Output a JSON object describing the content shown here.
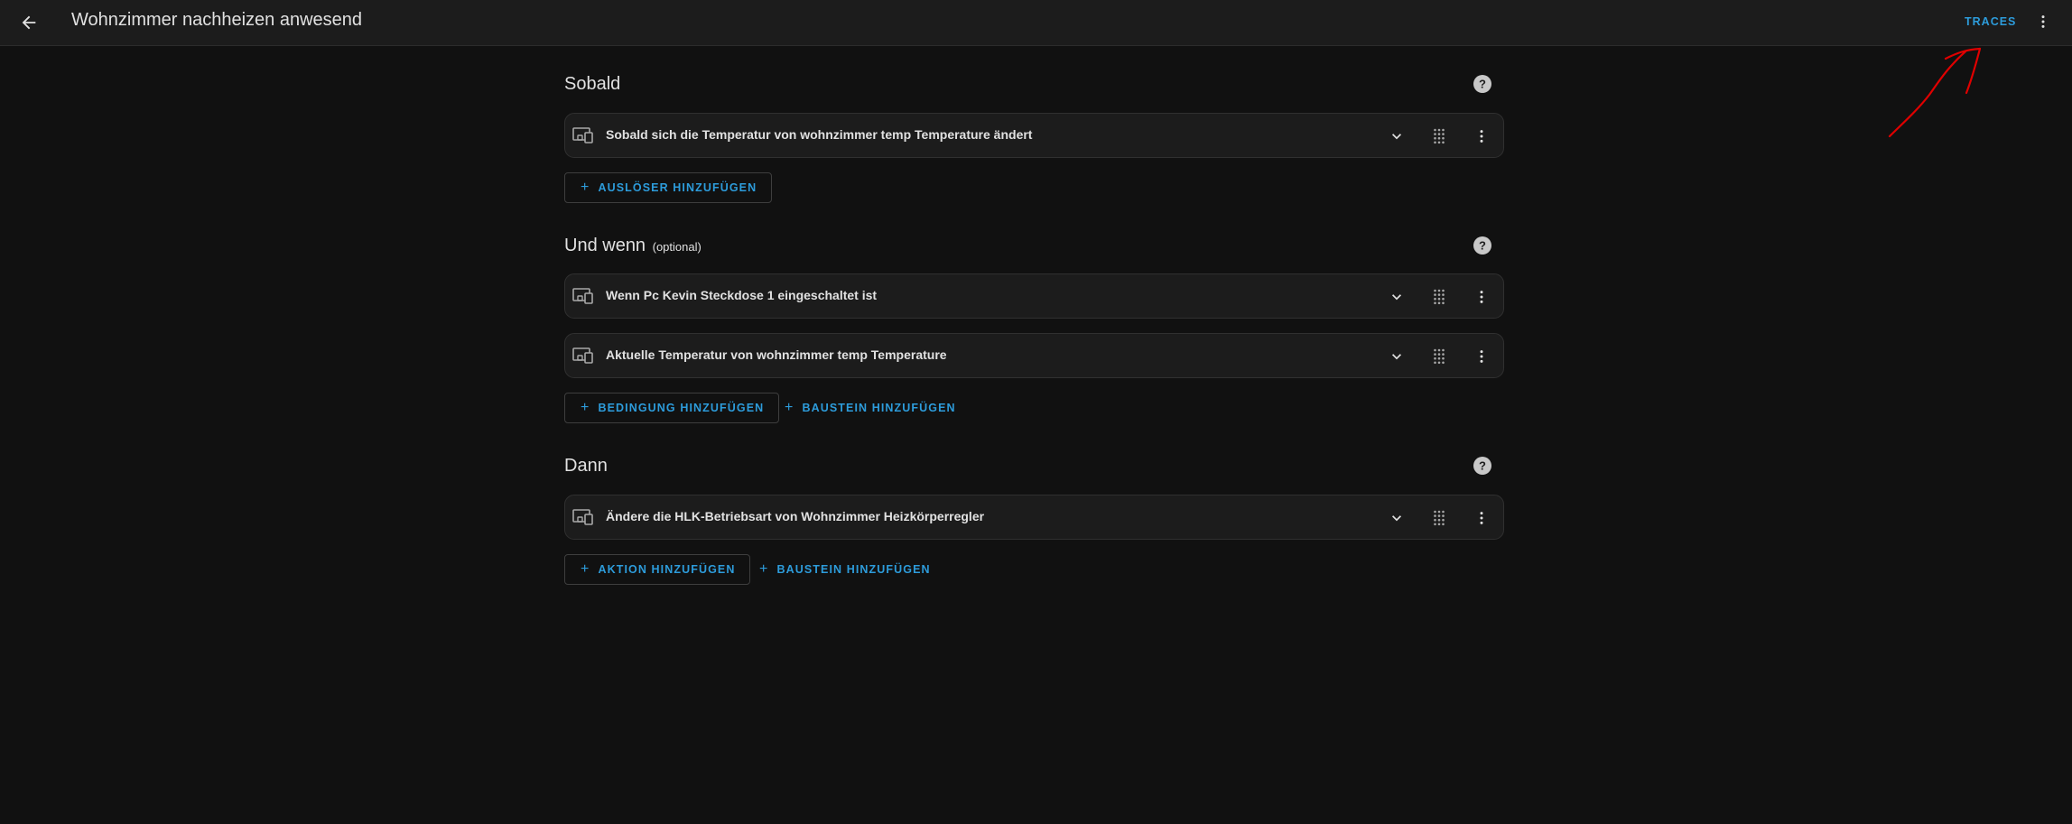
{
  "header": {
    "title": "Wohnzimmer nachheizen anwesend",
    "traces_label": "TRACES"
  },
  "sections": {
    "triggers": {
      "title": "Sobald",
      "items": [
        {
          "label": "Sobald sich die Temperatur von wohnzimmer temp Temperature ändert"
        }
      ],
      "add_label": "AUSLÖSER HINZUFÜGEN"
    },
    "conditions": {
      "title": "Und wenn",
      "subtitle": "(optional)",
      "items": [
        {
          "label": "Wenn Pc Kevin Steckdose 1 eingeschaltet ist"
        },
        {
          "label": "Aktuelle Temperatur von wohnzimmer temp Temperature"
        }
      ],
      "add_label": "BEDINGUNG HINZUFÜGEN",
      "add_block_label": "BAUSTEIN HINZUFÜGEN"
    },
    "actions": {
      "title": "Dann",
      "items": [
        {
          "label": "Ändere die HLK-Betriebsart von Wohnzimmer Heizkörperregler"
        }
      ],
      "add_label": "AKTION HINZUFÜGEN",
      "add_block_label": "BAUSTEIN HINZUFÜGEN"
    }
  },
  "icons": {
    "back": "arrow-left-icon",
    "overflow": "dots-vertical-icon",
    "help": "help-circle-icon",
    "device": "devices-icon",
    "expand": "chevron-down-icon",
    "drag": "drag-handle-icon",
    "plus": "plus-icon"
  },
  "colors": {
    "background": "#111111",
    "topbar": "#1c1c1c",
    "card": "#1c1c1c",
    "accent": "#2d9cdb",
    "text": "#e1e1e1",
    "annotation": "#e00000"
  }
}
